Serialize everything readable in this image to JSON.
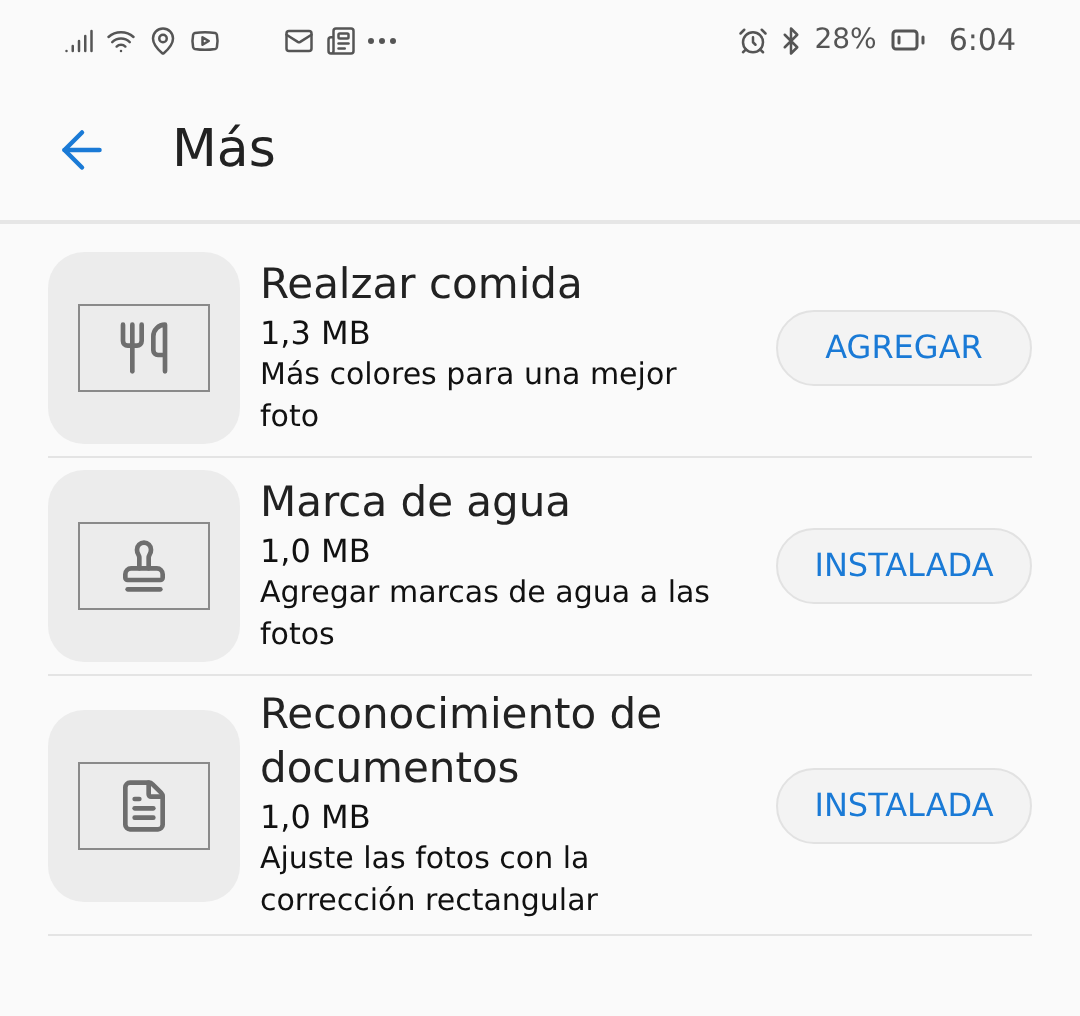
{
  "status_bar": {
    "battery": "28%",
    "time": "6:04"
  },
  "header": {
    "title": "Más"
  },
  "items": [
    {
      "kind": "food",
      "title": "Realzar comida",
      "size": "1,3 MB",
      "description": "Más colores para una mejor foto",
      "action": "AGREGAR"
    },
    {
      "kind": "stamp",
      "title": "Marca de agua",
      "size": "1,0 MB",
      "description": "Agregar marcas de agua a las fotos",
      "action": "INSTALADA"
    },
    {
      "kind": "document",
      "title": "Reconocimiento de documentos",
      "size": "1,0 MB",
      "description": "Ajuste las fotos con la corrección rectangular",
      "action": "INSTALADA"
    }
  ]
}
